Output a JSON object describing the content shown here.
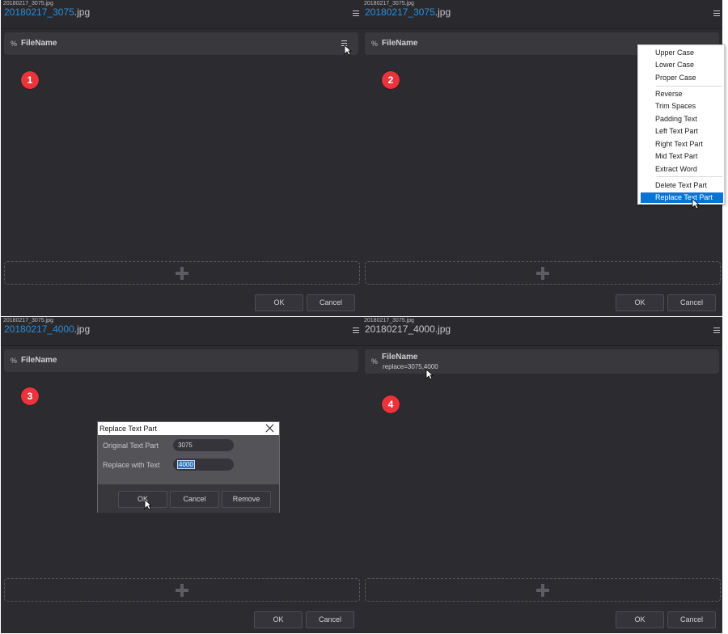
{
  "panels": [
    {
      "small_name": "20180217_3075.jpg",
      "big_name_highlight": "20180217_3075",
      "big_name_rest": ".jpg",
      "field_pct": "%",
      "field_name": "FileName",
      "badge": "1"
    },
    {
      "small_name": "20180217_3075.jpg",
      "big_name_highlight": "20180217_3075",
      "big_name_rest": ".jpg",
      "field_pct": "%",
      "field_name": "FileName",
      "badge": "2"
    },
    {
      "small_name": "20180217_3075.jpg",
      "big_name_highlight": "20180217_4000",
      "big_name_rest": ".jpg",
      "field_pct": "%",
      "field_name": "FileName",
      "badge": "3"
    },
    {
      "small_name": "20180217_3075.jpg",
      "big_name_plain": "20180217_4000.jpg",
      "field_pct": "%",
      "field_name": "FileName",
      "field_sub": "replace=3075,4000",
      "badge": "4"
    }
  ],
  "buttons": {
    "ok": "OK",
    "cancel": "Cancel"
  },
  "context_menu": {
    "items": [
      "Upper Case",
      "Lower Case",
      "Proper Case",
      "Reverse",
      "Trim Spaces",
      "Padding Text",
      "Left Text Part",
      "Right Text Part",
      "Mid Text Part",
      "Extract Word",
      "Delete Text Part",
      "Replace Text Part"
    ],
    "selected": "Replace Text Part"
  },
  "dialog": {
    "title": "Replace Text Part",
    "original_label": "Original Text Part",
    "original_value": "3075",
    "replace_label": "Replace with Text",
    "replace_value": "4000",
    "ok": "OK",
    "cancel": "Cancel",
    "remove": "Remove"
  },
  "colors": {
    "panel_bg": "#2c2b30",
    "accent": "#2a8fdc",
    "badge": "#e8343a",
    "menu_selected": "#0a74d6"
  }
}
